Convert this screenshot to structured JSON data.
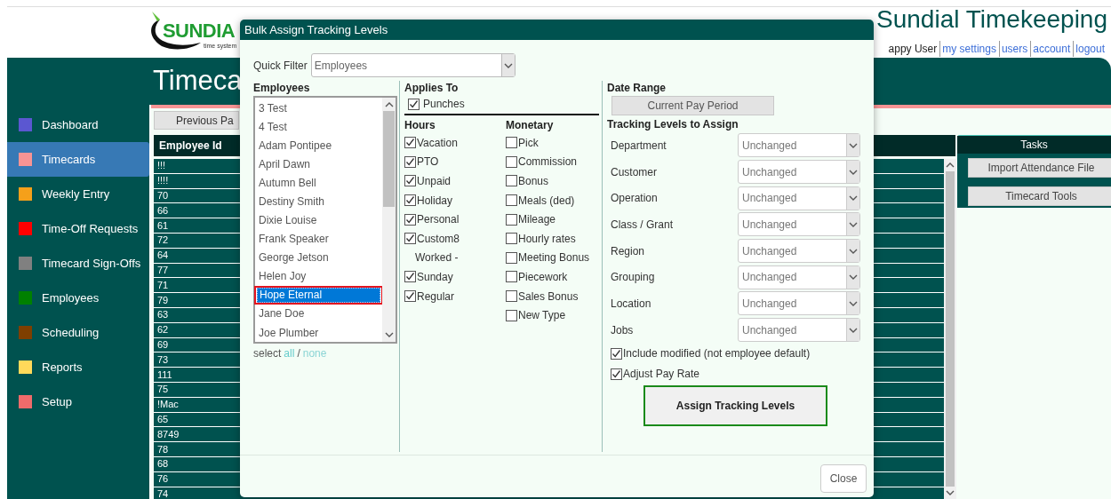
{
  "header": {
    "logo": {
      "name": "SUNDIA",
      "tagline": "time system"
    },
    "title": "Sundial Timekeeping",
    "user": "appy User",
    "links": [
      "my settings",
      "users",
      "account",
      "logout"
    ]
  },
  "page_title": "Timeca",
  "sidebar": {
    "items": [
      {
        "label": "Dashboard",
        "color": "#5b57d1",
        "selected": false
      },
      {
        "label": "Timecards",
        "color": "#f79494",
        "selected": true
      },
      {
        "label": "Weekly Entry",
        "color": "#f5a01a",
        "selected": false
      },
      {
        "label": "Time-Off Requests",
        "color": "#ff0000",
        "selected": false
      },
      {
        "label": "Timecard Sign-Offs",
        "color": "#808080",
        "selected": false
      },
      {
        "label": "Employees",
        "color": "#008000",
        "selected": false
      },
      {
        "label": "Scheduling",
        "color": "#7f3f00",
        "selected": false
      },
      {
        "label": "Reports",
        "color": "#ffd95a",
        "selected": false
      },
      {
        "label": "Setup",
        "color": "#ef6b6b",
        "selected": false
      }
    ]
  },
  "toolbar": {
    "previous_button": "Previous Pa"
  },
  "table": {
    "columns": [
      "Employee Id"
    ],
    "rows": [
      [
        "!!!"
      ],
      [
        "!!!!"
      ],
      [
        "70"
      ],
      [
        "66"
      ],
      [
        "61"
      ],
      [
        "72"
      ],
      [
        "64"
      ],
      [
        "77"
      ],
      [
        "71"
      ],
      [
        "79"
      ],
      [
        "63"
      ],
      [
        "62"
      ],
      [
        "69"
      ],
      [
        "73"
      ],
      [
        "111"
      ],
      [
        "75"
      ],
      [
        "!Mac"
      ],
      [
        "65"
      ],
      [
        "8749"
      ],
      [
        "78"
      ],
      [
        "68"
      ],
      [
        "76"
      ],
      [
        "74"
      ]
    ]
  },
  "tasks": {
    "title": "Tasks",
    "buttons": [
      "Import Attendance File",
      "Timecard Tools"
    ]
  },
  "dialog": {
    "title": "Bulk Assign Tracking Levels",
    "quick_filter": {
      "label": "Quick Filter",
      "value": "Employees"
    },
    "employees": {
      "heading": "Employees",
      "items": [
        {
          "name": "3 Test",
          "selected": false
        },
        {
          "name": "4 Test",
          "selected": false
        },
        {
          "name": "Adam Pontipee",
          "selected": false
        },
        {
          "name": "April Dawn",
          "selected": false
        },
        {
          "name": "Autumn Bell",
          "selected": false
        },
        {
          "name": "Destiny Smith",
          "selected": false
        },
        {
          "name": "Dixie Louise",
          "selected": false
        },
        {
          "name": "Frank Speaker",
          "selected": false
        },
        {
          "name": "George Jetson",
          "selected": false
        },
        {
          "name": "Helen Joy",
          "selected": false
        },
        {
          "name": "Hope Eternal",
          "selected": true
        },
        {
          "name": "Jane Doe",
          "selected": false
        },
        {
          "name": "Joe Plumber",
          "selected": false
        }
      ],
      "select_label": "select",
      "select_all": "all",
      "separator": "/",
      "select_none": "none"
    },
    "applies_to": {
      "heading": "Applies To",
      "items": [
        {
          "label": "Punches",
          "checked": true
        }
      ]
    },
    "hours": {
      "heading": "Hours",
      "items": [
        {
          "kind": "checkbox",
          "label": "Vacation",
          "checked": true
        },
        {
          "kind": "checkbox",
          "label": "PTO",
          "checked": true
        },
        {
          "kind": "checkbox",
          "label": "Unpaid",
          "checked": true
        },
        {
          "kind": "checkbox",
          "label": "Holiday",
          "checked": true
        },
        {
          "kind": "checkbox",
          "label": "Personal",
          "checked": true
        },
        {
          "kind": "checkbox",
          "label": "Custom8",
          "checked": true
        },
        {
          "kind": "label",
          "label": "Worked -"
        },
        {
          "kind": "checkbox",
          "label": "Sunday",
          "checked": true
        },
        {
          "kind": "checkbox",
          "label": "Regular",
          "checked": true
        }
      ]
    },
    "monetary": {
      "heading": "Monetary",
      "items": [
        {
          "kind": "checkbox",
          "label": "Pick",
          "checked": false
        },
        {
          "kind": "checkbox",
          "label": "Commission",
          "checked": false
        },
        {
          "kind": "checkbox",
          "label": "Bonus",
          "checked": false
        },
        {
          "kind": "checkbox",
          "label": "Meals (ded)",
          "checked": false
        },
        {
          "kind": "checkbox",
          "label": "Mileage",
          "checked": false
        },
        {
          "kind": "checkbox",
          "label": "Hourly rates",
          "checked": false
        },
        {
          "kind": "checkbox",
          "label": "Meeting Bonus",
          "checked": false
        },
        {
          "kind": "checkbox",
          "label": "Piecework",
          "checked": false
        },
        {
          "kind": "checkbox",
          "label": "Sales Bonus",
          "checked": false
        },
        {
          "kind": "checkbox",
          "label": "New Type",
          "checked": false
        }
      ]
    },
    "date_range": {
      "heading": "Date Range",
      "button": "Current Pay Period"
    },
    "tracking": {
      "heading": "Tracking Levels to Assign",
      "rows": [
        {
          "label": "Department",
          "value": "Unchanged"
        },
        {
          "label": "Customer",
          "value": "Unchanged"
        },
        {
          "label": "Operation",
          "value": "Unchanged"
        },
        {
          "label": "Class / Grant",
          "value": "Unchanged"
        },
        {
          "label": "Region",
          "value": "Unchanged"
        },
        {
          "label": "Grouping",
          "value": "Unchanged"
        },
        {
          "label": "Location",
          "value": "Unchanged"
        },
        {
          "label": "Jobs",
          "value": "Unchanged"
        }
      ]
    },
    "options": [
      {
        "label": "Include modified (not employee default)",
        "checked": true
      },
      {
        "label": "Adjust Pay Rate",
        "checked": true
      }
    ],
    "assign_button": "Assign Tracking Levels",
    "close_button": "Close"
  }
}
